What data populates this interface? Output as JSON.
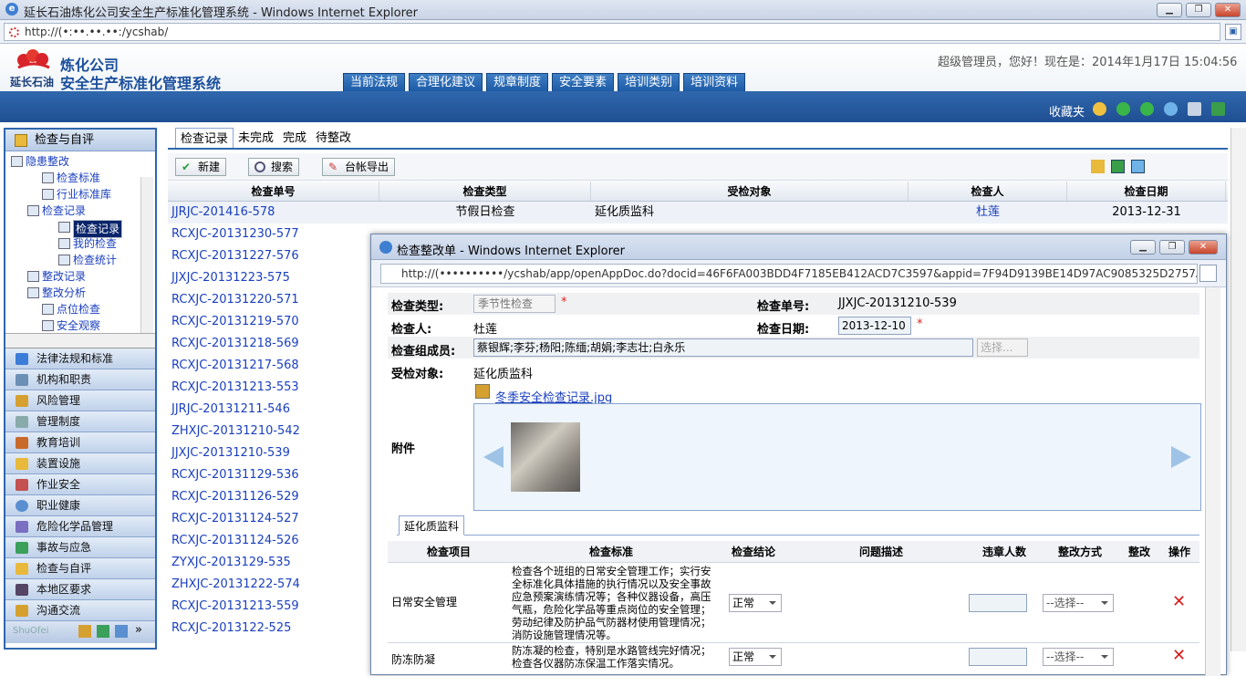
{
  "window": {
    "title": "延长石油炼化公司安全生产标准化管理系统 - Windows Internet Explorer",
    "address": "http://(•:••.••.••:/ycshab/"
  },
  "header": {
    "company": "炼化公司",
    "logo_sub": "延长石油",
    "system_name": "安全生产标准化管理系统",
    "greeting": "超级管理员，您好！现在是：2014年1月17日 15:04:56",
    "nav": [
      "当前法规",
      "合理化建议",
      "规章制度",
      "安全要素",
      "培训类别",
      "培训资料"
    ],
    "favorites": "收藏夹"
  },
  "sidebar": {
    "title": "检查与自评",
    "tree": [
      {
        "label": "隐患整改",
        "level": 0
      },
      {
        "label": "检查标准",
        "level": 1
      },
      {
        "label": "行业标准库",
        "level": 1
      },
      {
        "label": "检查记录",
        "level": 1
      },
      {
        "label": "检查记录",
        "level": 2,
        "selected": true
      },
      {
        "label": "我的检查",
        "level": 2
      },
      {
        "label": "检查统计",
        "level": 2
      },
      {
        "label": "整改记录",
        "level": 1
      },
      {
        "label": "整改分析",
        "level": 1
      },
      {
        "label": "点位检查",
        "level": 1
      },
      {
        "label": "安全观察",
        "level": 1
      }
    ],
    "accordion": [
      "法律法规和标准",
      "机构和职责",
      "风险管理",
      "管理制度",
      "教育培训",
      "装置设施",
      "作业安全",
      "职业健康",
      "危险化学品管理",
      "事故与应急",
      "检查与自评",
      "本地区要求",
      "沟通交流"
    ],
    "footer_text": "ShuOfei"
  },
  "main": {
    "tabs": [
      "检查记录",
      "未完成",
      "完成",
      "待整改"
    ],
    "toolbar": {
      "new": "新建",
      "search": "搜索",
      "export": "台帐导出"
    },
    "columns": [
      "检查单号",
      "检查类型",
      "受检对象",
      "检查人",
      "检查日期"
    ],
    "rows": [
      {
        "id": "JJRJC-201416-578",
        "type": "节假日检查",
        "target": "延化质监科",
        "inspector": "杜莲",
        "date": "2013-12-31"
      },
      {
        "id": "RCXJC-20131230-577"
      },
      {
        "id": "RCXJC-20131227-576"
      },
      {
        "id": "JJXJC-20131223-575"
      },
      {
        "id": "RCXJC-20131220-571"
      },
      {
        "id": "RCXJC-20131219-570"
      },
      {
        "id": "RCXJC-20131218-569"
      },
      {
        "id": "RCXJC-20131217-568"
      },
      {
        "id": "RCXJC-20131213-553"
      },
      {
        "id": "JJRJC-20131211-546"
      },
      {
        "id": "ZHXJC-20131210-542"
      },
      {
        "id": "JJXJC-20131210-539"
      },
      {
        "id": "RCXJC-20131129-536"
      },
      {
        "id": "RCXJC-20131126-529"
      },
      {
        "id": "RCXJC-20131124-527"
      },
      {
        "id": "RCXJC-20131124-526"
      },
      {
        "id": "ZYXJC-2013129-535"
      },
      {
        "id": "ZHXJC-20131222-574"
      },
      {
        "id": "RCXJC-20131213-559"
      },
      {
        "id": "RCXJC-2013122-525"
      }
    ]
  },
  "popup": {
    "title": "检查整改单 - Windows Internet Explorer",
    "address": "http://(••••••••••/ycshab/app/openAppDoc.do?docid=46F6FA003BDD4F7185EB412ACD7C3597&appid=7F94D9139BE14D97AC9085325D2757AD",
    "form": {
      "type_label": "检查类型:",
      "type_value": "季节性检查",
      "no_label": "检查单号:",
      "no_value": "JJXJC-20131210-539",
      "inspector_label": "检查人:",
      "inspector_value": "杜莲",
      "date_label": "检查日期:",
      "date_value": "2013-12-10",
      "members_label": "检查组成员:",
      "members_value": "蔡银辉;李芬;杨阳;陈缅;胡娟;李志壮;白永乐",
      "choose": "选择...",
      "target_label": "受检对象:",
      "target_value": "延化质监科",
      "attach_label": "附件",
      "attach_file": "冬季安全检查记录.jpg"
    },
    "subtab": "延化质监科",
    "table": {
      "columns": [
        "检查项目",
        "检查标准",
        "检查结论",
        "问题描述",
        "违章人数",
        "整改方式",
        "整改",
        "操作"
      ],
      "rows": [
        {
          "item": "日常安全管理",
          "standard": "检查各个班组的日常安全管理工作；实行安全标准化具体措施的执行情况以及安全事故应急预案演练情况等；各种仪器设备，高压气瓶，危险化学品等重点岗位的安全管理；劳动纪律及防护品气防器材使用管理情况；消防设施管理情况等。",
          "result": "正常",
          "method": "--选择--"
        },
        {
          "item": "防冻防凝",
          "standard": "防冻凝的检查，特别是水路管线完好情况；检查各仪器防冻保温工作落实情况。",
          "result": "正常",
          "method": "--选择--"
        }
      ]
    }
  },
  "colors": {
    "accent": "#2f67ad",
    "link": "#1a3fbf",
    "required": "#e02020"
  }
}
